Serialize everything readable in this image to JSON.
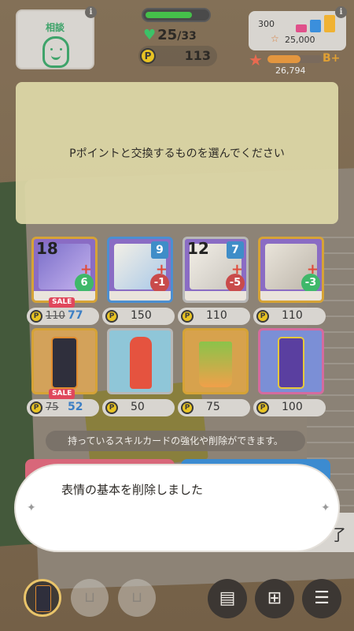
{
  "hud": {
    "consult_label": "相談",
    "stamina": {
      "current": "25",
      "max": "/33",
      "fraction": 0.76
    },
    "p_points": "113",
    "p_symbol": "P",
    "stats_total": "300",
    "fan_count": "25,000",
    "rank_points": "26,794",
    "rank_badge": "B+",
    "rank_fraction": 0.6,
    "info_symbol": "i"
  },
  "prompt": {
    "text": "Pポイントと交換するものを選んでください"
  },
  "shop": {
    "items": [
      {
        "kind": "skill-card",
        "label": "18",
        "gem": "",
        "mod": "6",
        "sale": true,
        "price_old": "110",
        "price": "77"
      },
      {
        "kind": "skill-card",
        "label": "",
        "gem": "9",
        "mod": "-1",
        "sale": false,
        "price": "150"
      },
      {
        "kind": "skill-card",
        "label": "12",
        "gem": "7",
        "mod": "-5",
        "sale": false,
        "price": "110"
      },
      {
        "kind": "skill-card",
        "label": "",
        "gem": "",
        "mod": "-3",
        "sale": false,
        "price": "110"
      },
      {
        "kind": "drink-can",
        "sale": true,
        "price_old": "75",
        "price": "52"
      },
      {
        "kind": "drink-bottle",
        "sale": false,
        "price": "50"
      },
      {
        "kind": "drink-glass",
        "sale": false,
        "price": "75"
      },
      {
        "kind": "drink-can-purple",
        "sale": false,
        "price": "100"
      }
    ],
    "sale_label": "SALE"
  },
  "hint": {
    "text": "持っているスキルカードの強化や削除ができます。"
  },
  "toast": {
    "text": "表情の基本を削除しました",
    "side_text": "了"
  },
  "nav": {
    "menu_icon": "☰",
    "colors": {
      "accent": "#e9c46a",
      "sale": "#e0475c",
      "price_sale": "#3d7fc4"
    }
  }
}
